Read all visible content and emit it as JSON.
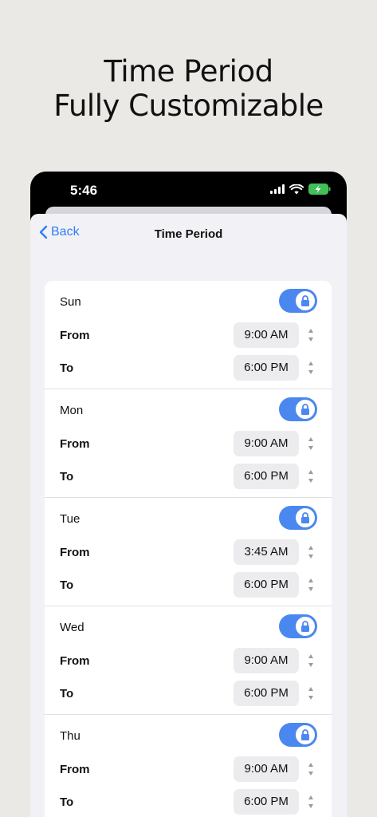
{
  "headline": {
    "line1": "Time Period",
    "line2": "Fully Customizable"
  },
  "status_bar": {
    "time": "5:46",
    "icons": [
      "signal-icon",
      "wifi-icon",
      "battery-charging-icon"
    ]
  },
  "nav": {
    "back_label": "Back",
    "title": "Time Period"
  },
  "labels": {
    "from": "From",
    "to": "To"
  },
  "colors": {
    "accent": "#2f7cf6",
    "toggle_on": "#4a88ef",
    "background": "#ebe9e6"
  },
  "days": [
    {
      "name": "Sun",
      "enabled": true,
      "from": "9:00 AM",
      "to": "6:00 PM"
    },
    {
      "name": "Mon",
      "enabled": true,
      "from": "9:00 AM",
      "to": "6:00 PM"
    },
    {
      "name": "Tue",
      "enabled": true,
      "from": "3:45 AM",
      "to": "6:00 PM"
    },
    {
      "name": "Wed",
      "enabled": true,
      "from": "9:00 AM",
      "to": "6:00 PM"
    },
    {
      "name": "Thu",
      "enabled": true,
      "from": "9:00 AM",
      "to": "6:00 PM"
    }
  ]
}
